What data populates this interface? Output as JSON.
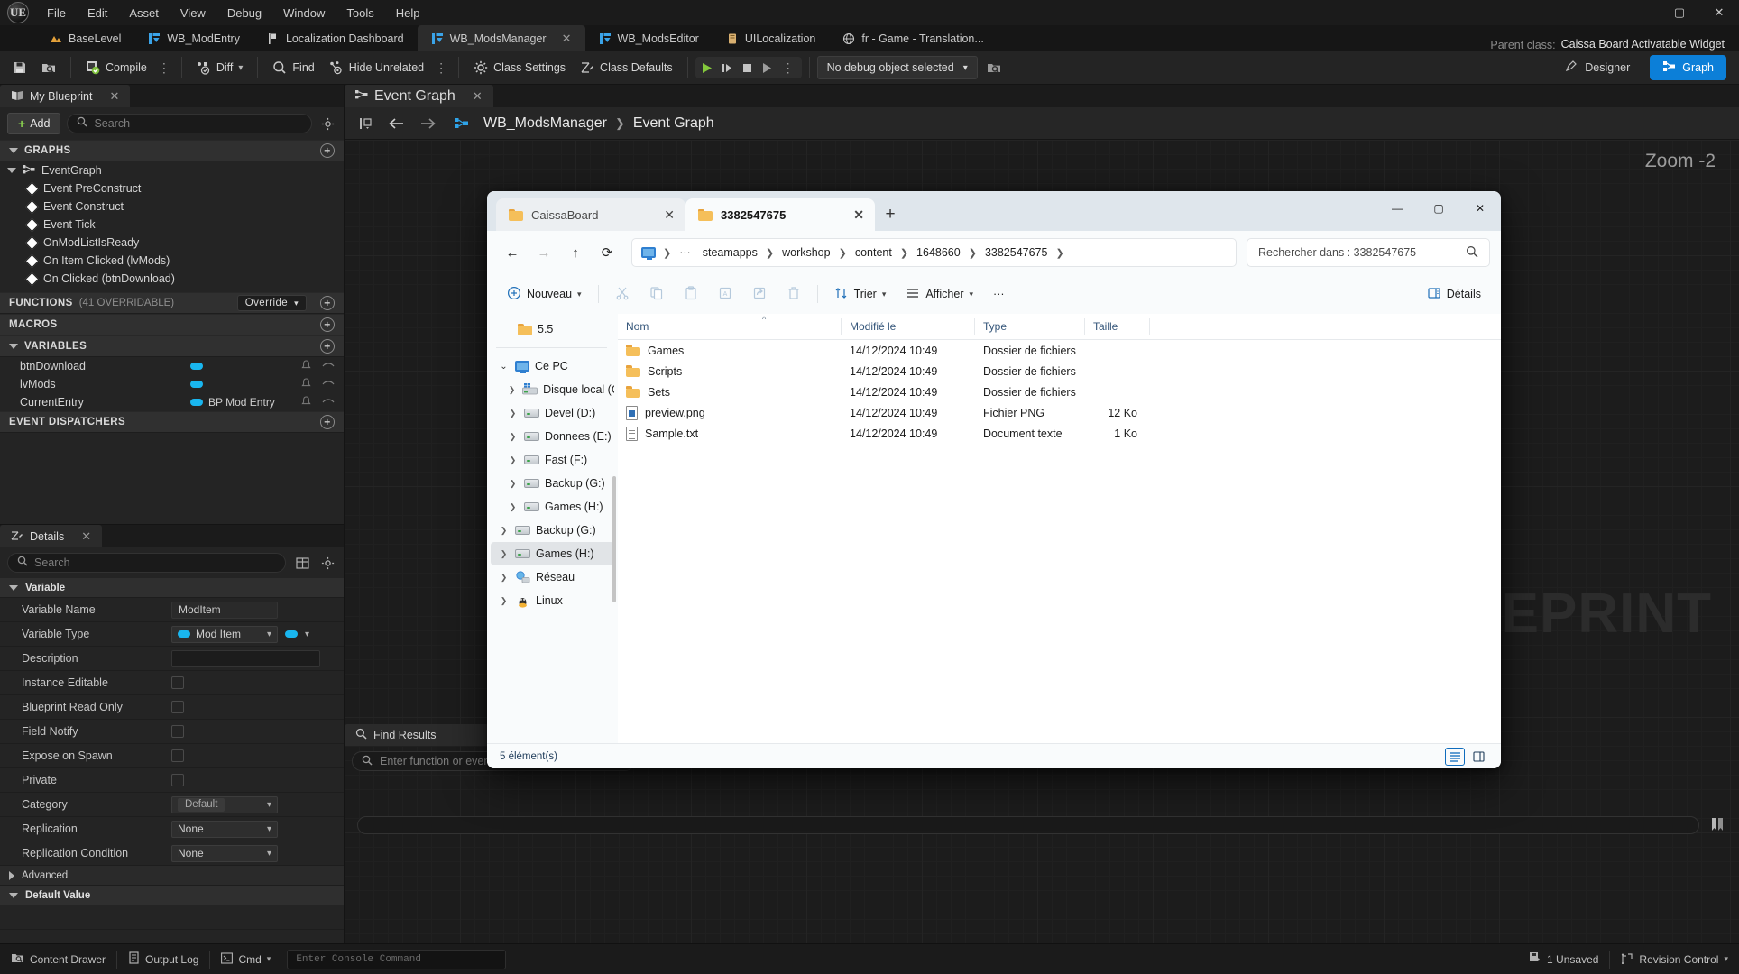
{
  "unreal": {
    "menu": [
      "File",
      "Edit",
      "Asset",
      "View",
      "Debug",
      "Window",
      "Tools",
      "Help"
    ],
    "window_controls": {
      "minimize": "–",
      "maximize": "▢",
      "close": "✕"
    },
    "asset_tabs": [
      {
        "label": "BaseLevel",
        "icon": "level-icon",
        "active": false,
        "closable": false
      },
      {
        "label": "WB_ModEntry",
        "icon": "widget-icon",
        "active": false,
        "closable": false
      },
      {
        "label": "Localization Dashboard",
        "icon": "flag-icon",
        "active": false,
        "closable": false
      },
      {
        "label": "WB_ModsManager",
        "icon": "widget-icon",
        "active": true,
        "closable": true
      },
      {
        "label": "WB_ModsEditor",
        "icon": "widget-icon",
        "active": false,
        "closable": false
      },
      {
        "label": "UILocalization",
        "icon": "localization-icon",
        "active": false,
        "closable": false
      },
      {
        "label": "fr - Game - Translation...",
        "icon": "globe-icon",
        "active": false,
        "closable": false
      }
    ],
    "parent_class": {
      "label": "Parent class:",
      "value": "Caissa Board Activatable Widget"
    },
    "toolbar": {
      "save_title": "Save",
      "browse_title": "Browse",
      "compile": "Compile",
      "diff": "Diff",
      "find": "Find",
      "hide_unrelated": "Hide Unrelated",
      "class_settings": "Class Settings",
      "class_defaults": "Class Defaults",
      "debug_object": "No debug object selected",
      "play": "Play",
      "pause": "Pause",
      "stop": "Stop",
      "skip": "Skip",
      "designer_mode": "Designer",
      "graph_mode": "Graph"
    },
    "my_blueprint": {
      "tab_label": "My Blueprint",
      "add_label": "Add",
      "search_placeholder": "Search",
      "sections": {
        "graphs": "GRAPHS",
        "functions": "FUNCTIONS",
        "functions_sub": "(41 OVERRIDABLE)",
        "functions_override": "Override",
        "macros": "MACROS",
        "variables": "VARIABLES",
        "event_dispatchers": "EVENT DISPATCHERS"
      },
      "graph_root": "EventGraph",
      "events": [
        "Event PreConstruct",
        "Event Construct",
        "Event Tick",
        "OnModListIsReady",
        "On Item Clicked (lvMods)",
        "On Clicked (btnDownload)"
      ],
      "variables": [
        {
          "name": "btnDownload",
          "type": ""
        },
        {
          "name": "lvMods",
          "type": ""
        },
        {
          "name": "CurrentEntry",
          "type": "BP Mod Entry"
        }
      ]
    },
    "details": {
      "tab_label": "Details",
      "search_placeholder": "Search",
      "category_variable": "Variable",
      "category_default_value": "Default Value",
      "category_advanced": "Advanced",
      "rows": [
        {
          "label": "Variable Name",
          "kind": "text",
          "value": "ModItem"
        },
        {
          "label": "Variable Type",
          "kind": "type",
          "value": "Mod Item"
        },
        {
          "label": "Description",
          "kind": "textwide",
          "value": ""
        },
        {
          "label": "Instance Editable",
          "kind": "check",
          "value": ""
        },
        {
          "label": "Blueprint Read Only",
          "kind": "check",
          "value": ""
        },
        {
          "label": "Field Notify",
          "kind": "check",
          "value": ""
        },
        {
          "label": "Expose on Spawn",
          "kind": "check",
          "value": ""
        },
        {
          "label": "Private",
          "kind": "check",
          "value": ""
        },
        {
          "label": "Category",
          "kind": "combo_inner",
          "value": "Default"
        },
        {
          "label": "Replication",
          "kind": "combo",
          "value": "None"
        },
        {
          "label": "Replication Condition",
          "kind": "combo",
          "value": "None"
        }
      ]
    },
    "graph": {
      "tab_label": "Event Graph",
      "breadcrumb_root": "WB_ModsManager",
      "breadcrumb_leaf": "Event Graph",
      "zoom": "Zoom -2",
      "watermark": "BLUEPRINT",
      "find_results_tab": "Find Results",
      "find_placeholder": "Enter function or event name to find references..."
    },
    "status_bar": {
      "content_drawer": "Content Drawer",
      "output_log": "Output Log",
      "cmd": "Cmd",
      "console_placeholder": "Enter Console Command",
      "unsaved": "1 Unsaved",
      "revision_control": "Revision Control"
    }
  },
  "explorer": {
    "tabs": [
      {
        "label": "CaissaBoard",
        "active": false
      },
      {
        "label": "3382547675",
        "active": true
      }
    ],
    "new_tab_label": "+",
    "window_controls": {
      "minimize": "—",
      "maximize": "▢",
      "close": "✕"
    },
    "nav": {
      "back": "←",
      "forward": "→",
      "up": "↑",
      "refresh": "⟳",
      "overflow": "···",
      "breadcrumbs": [
        "steamapps",
        "workshop",
        "content",
        "1648660",
        "3382547675"
      ],
      "search_placeholder": "Rechercher dans : 3382547675"
    },
    "commandbar": {
      "new": "Nouveau",
      "cut": "cut-icon",
      "copy": "copy-icon",
      "paste": "paste-icon",
      "rename": "rename-icon",
      "share": "share-icon",
      "delete": "delete-icon",
      "sort": "Trier",
      "view": "Afficher",
      "more": "···",
      "details": "Détails"
    },
    "tree": [
      {
        "label": "5.5",
        "icon": "folder-icon",
        "indent": 1,
        "chevron": "",
        "selected": false
      },
      {
        "label": "Ce PC",
        "icon": "pc-icon",
        "indent": 0,
        "chevron": "v",
        "selected": false
      },
      {
        "label": "Disque local (C:)",
        "icon": "drive-windows-icon",
        "indent": 1,
        "chevron": ">",
        "selected": false
      },
      {
        "label": "Devel (D:)",
        "icon": "drive-icon",
        "indent": 1,
        "chevron": ">",
        "selected": false
      },
      {
        "label": "Donnees (E:)",
        "icon": "drive-icon",
        "indent": 1,
        "chevron": ">",
        "selected": false
      },
      {
        "label": "Fast (F:)",
        "icon": "drive-icon",
        "indent": 1,
        "chevron": ">",
        "selected": false
      },
      {
        "label": "Backup (G:)",
        "icon": "drive-icon",
        "indent": 1,
        "chevron": ">",
        "selected": false
      },
      {
        "label": "Games (H:)",
        "icon": "drive-icon",
        "indent": 1,
        "chevron": ">",
        "selected": false
      },
      {
        "label": "Backup (G:)",
        "icon": "drive-icon",
        "indent": 0,
        "chevron": ">",
        "selected": false
      },
      {
        "label": "Games (H:)",
        "icon": "drive-icon",
        "indent": 0,
        "chevron": ">",
        "selected": true
      },
      {
        "label": "Réseau",
        "icon": "network-icon",
        "indent": 0,
        "chevron": ">",
        "selected": false
      },
      {
        "label": "Linux",
        "icon": "linux-icon",
        "indent": 0,
        "chevron": ">",
        "selected": false
      }
    ],
    "columns": [
      "Nom",
      "Modifié le",
      "Type",
      "Taille"
    ],
    "files": [
      {
        "name": "Games",
        "modified": "14/12/2024 10:49",
        "type": "Dossier de fichiers",
        "size": "",
        "icon": "folder-icon"
      },
      {
        "name": "Scripts",
        "modified": "14/12/2024 10:49",
        "type": "Dossier de fichiers",
        "size": "",
        "icon": "folder-icon"
      },
      {
        "name": "Sets",
        "modified": "14/12/2024 10:49",
        "type": "Dossier de fichiers",
        "size": "",
        "icon": "folder-icon"
      },
      {
        "name": "preview.png",
        "modified": "14/12/2024 10:49",
        "type": "Fichier PNG",
        "size": "12 Ko",
        "icon": "png-file-icon"
      },
      {
        "name": "Sample.txt",
        "modified": "14/12/2024 10:49",
        "type": "Document texte",
        "size": "1 Ko",
        "icon": "txt-file-icon"
      }
    ],
    "status": "5 élément(s)",
    "view_toggles": [
      "list-view-icon",
      "details-pane-icon"
    ]
  },
  "colors": {
    "accent_blue": "#0c7fd8",
    "pin_blue": "#19b6ef",
    "compile_green": "#8bd450",
    "explorer_bg": "#f3f3f3",
    "ue_bg": "#242424"
  }
}
